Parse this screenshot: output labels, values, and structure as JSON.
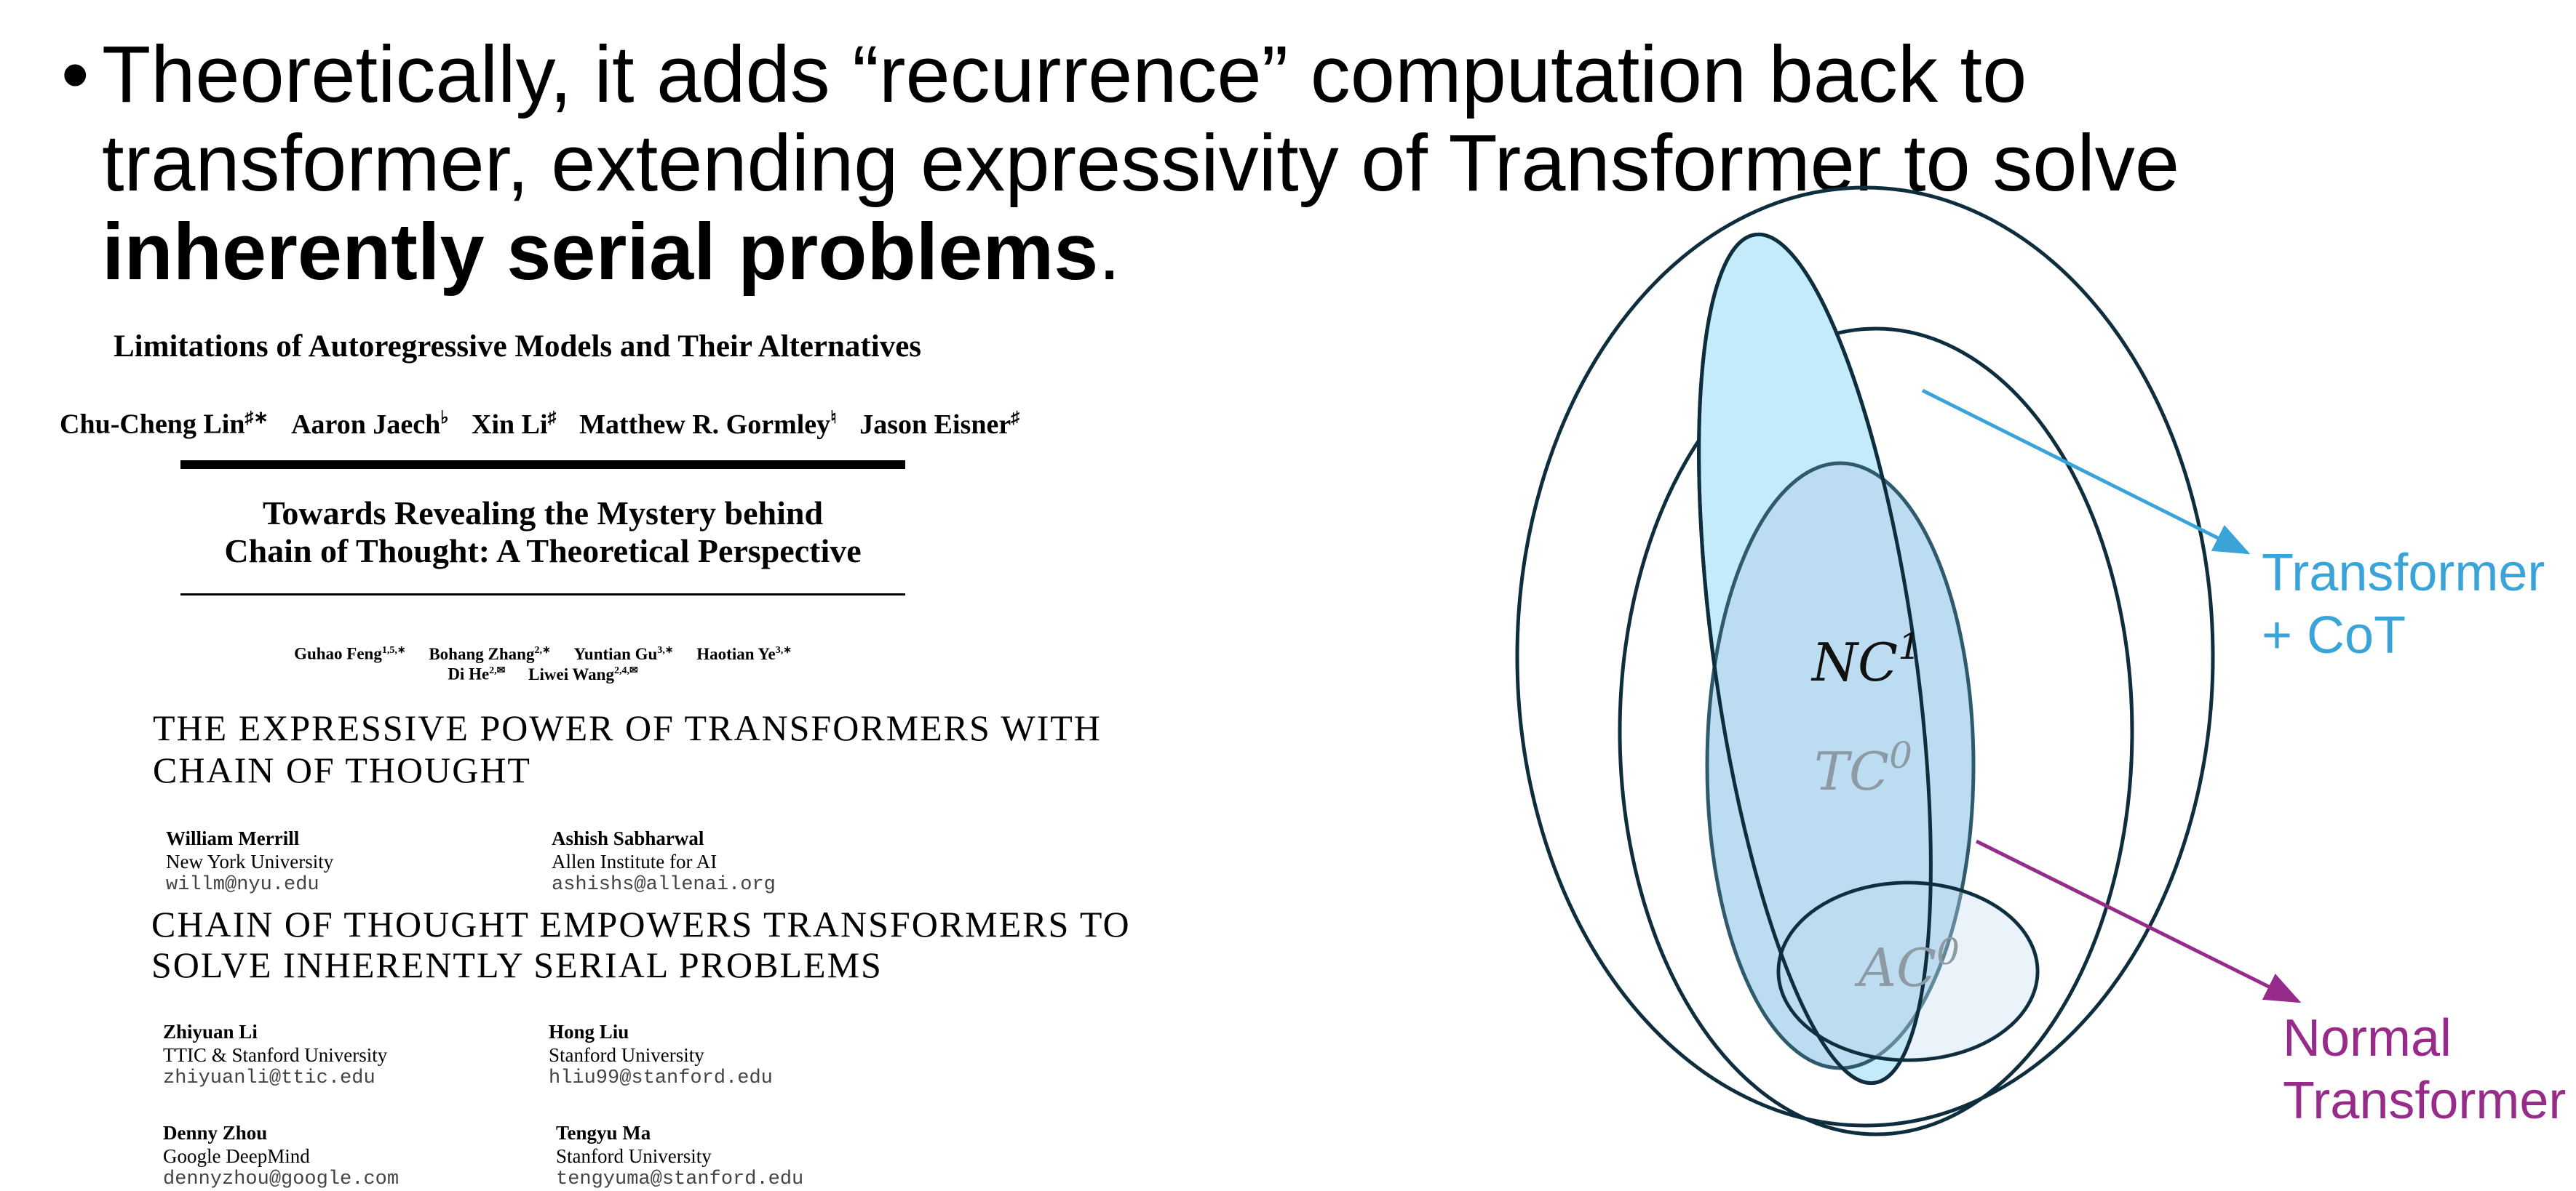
{
  "bullet": {
    "symbol": "•",
    "line1": "Theoretically, it adds “recurrence” computation back to",
    "line2": "transformer, extending expressivity of Transformer to solve",
    "line3_bold": "inherently serial problems",
    "line3_tail": "."
  },
  "paper1": {
    "title": "Limitations of Autoregressive Models and Their Alternatives",
    "authors": [
      {
        "name": "Chu-Cheng Lin",
        "sup": "♯∗"
      },
      {
        "name": "Aaron Jaech",
        "sup": "♭"
      },
      {
        "name": "Xin Li",
        "sup": "♯"
      },
      {
        "name": "Matthew R. Gormley",
        "sup": "♮"
      },
      {
        "name": "Jason Eisner",
        "sup": "♯"
      }
    ]
  },
  "paper2": {
    "title_line1": "Towards Revealing the Mystery behind",
    "title_line2": "Chain of Thought: A Theoretical Perspective",
    "authors_line1": [
      {
        "name": "Guhao Feng",
        "sup": "1,5,∗"
      },
      {
        "name": "Bohang Zhang",
        "sup": "2,∗"
      },
      {
        "name": "Yuntian Gu",
        "sup": "3,∗"
      },
      {
        "name": "Haotian Ye",
        "sup": "3,∗"
      }
    ],
    "authors_line2": [
      {
        "name": "Di He",
        "sup": "2,✉"
      },
      {
        "name": "Liwei Wang",
        "sup": "2,4,✉"
      }
    ]
  },
  "paper3": {
    "title_line1": "THE EXPRESSIVE POWER OF TRANSFORMERS WITH",
    "title_line2": "CHAIN OF THOUGHT",
    "authors": [
      {
        "name": "William Merrill",
        "affil": "New York University",
        "email": "willm@nyu.edu"
      },
      {
        "name": "Ashish Sabharwal",
        "affil": "Allen Institute for AI",
        "email": "ashishs@allenai.org"
      }
    ]
  },
  "paper4": {
    "title_line1": "CHAIN OF THOUGHT EMPOWERS TRANSFORMERS TO",
    "title_line2": "SOLVE INHERENTLY SERIAL PROBLEMS",
    "authors": [
      {
        "name": "Zhiyuan Li",
        "affil": "TTIC & Stanford University",
        "email": "zhiyuanli@ttic.edu"
      },
      {
        "name": "Hong Liu",
        "affil": "Stanford University",
        "email": "hliu99@stanford.edu"
      },
      {
        "name": "Denny Zhou",
        "affil": "Google DeepMind",
        "email": "dennyzhou@google.com"
      },
      {
        "name": "Tengyu Ma",
        "affil": "Stanford University",
        "email": "tengyuma@stanford.edu"
      }
    ]
  },
  "diagram": {
    "nc1_base": "NC",
    "nc1_sup": "1",
    "tc0_base": "TC",
    "tc0_sup": "0",
    "ac0_base": "AC",
    "ac0_sup": "0",
    "label_cot_line1": "Transformer",
    "label_cot_line2": "+ CoT",
    "label_normal_line1": "Normal",
    "label_normal_line2": "Transformer",
    "colors": {
      "cot": "#3aa4d8",
      "normal": "#962b8a",
      "outline": "#0e2d3d",
      "cot_fill": "#c4ebf9",
      "tc0_fill": "#bcdcf2",
      "nc1_text": "#111111",
      "faded_text": "#8d9aa4"
    }
  }
}
